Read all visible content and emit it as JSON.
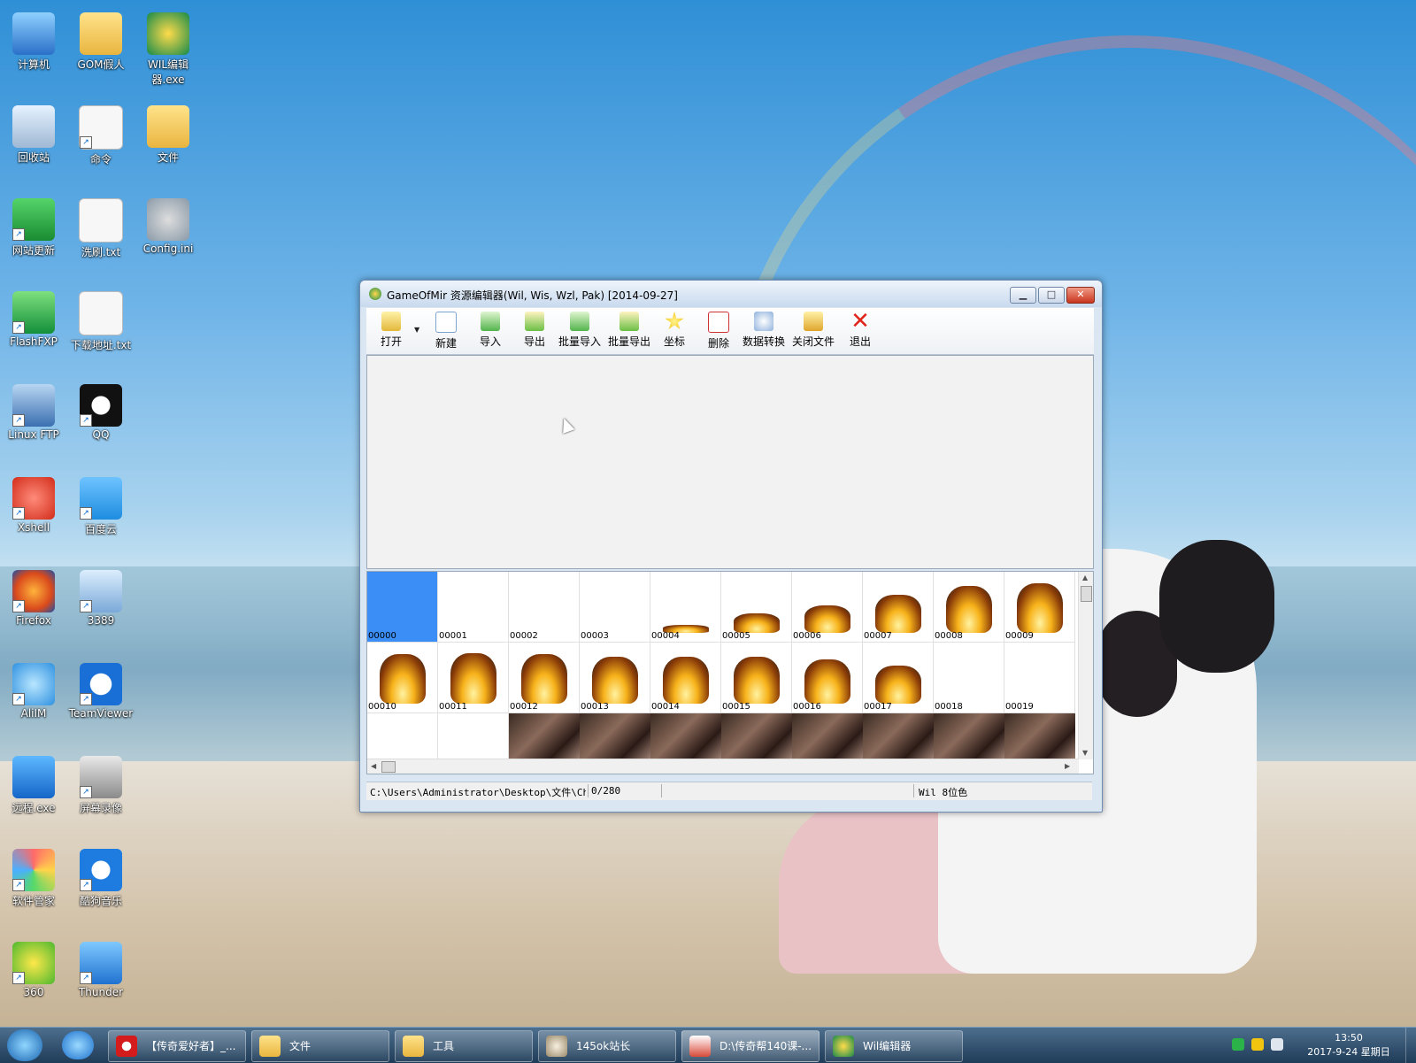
{
  "desktop": {
    "icons": [
      {
        "label": "计算机",
        "icon": "computer-icon",
        "shortcut": false
      },
      {
        "label": "GOM假人",
        "icon": "folder-icon",
        "shortcut": false
      },
      {
        "label": "WIL编辑器.exe",
        "icon": "wil-editor-icon",
        "shortcut": false
      },
      {
        "label": "回收站",
        "icon": "recycle-bin-icon",
        "shortcut": false
      },
      {
        "label": "命令",
        "icon": "document-icon",
        "shortcut": true
      },
      {
        "label": "文件",
        "icon": "folder-icon",
        "shortcut": false
      },
      {
        "label": "网站更新",
        "icon": "shield-icon",
        "shortcut": true
      },
      {
        "label": "洗刷.txt",
        "icon": "text-file-icon",
        "shortcut": false
      },
      {
        "label": "Config.ini",
        "icon": "config-file-icon",
        "shortcut": false
      },
      {
        "label": "FlashFXP",
        "icon": "flashfxp-icon",
        "shortcut": true
      },
      {
        "label": "下载地址.txt",
        "icon": "text-file-icon",
        "shortcut": false
      },
      {
        "label": "Linux FTP",
        "icon": "ftp-icon",
        "shortcut": true
      },
      {
        "label": "QQ",
        "icon": "qq-icon",
        "shortcut": true
      },
      {
        "label": "Xshell",
        "icon": "xshell-icon",
        "shortcut": true
      },
      {
        "label": "百度云",
        "icon": "baidu-cloud-icon",
        "shortcut": true
      },
      {
        "label": "Firefox",
        "icon": "firefox-icon",
        "shortcut": true
      },
      {
        "label": "3389",
        "icon": "monitor-icon",
        "shortcut": true
      },
      {
        "label": "AliIM",
        "icon": "aliim-icon",
        "shortcut": true
      },
      {
        "label": "TeamViewer",
        "icon": "teamviewer-icon",
        "shortcut": true
      },
      {
        "label": "远程.exe",
        "icon": "remote-icon",
        "shortcut": false
      },
      {
        "label": "屏幕录像",
        "icon": "screen-recorder-icon",
        "shortcut": true
      },
      {
        "label": "软件管家",
        "icon": "software-manager-icon",
        "shortcut": true
      },
      {
        "label": "酷狗音乐",
        "icon": "kugou-icon",
        "shortcut": true
      },
      {
        "label": "360",
        "icon": "360-icon",
        "shortcut": true
      },
      {
        "label": "Thunder",
        "icon": "thunder-icon",
        "shortcut": true
      }
    ]
  },
  "window": {
    "title": "GameOfMir 资源编辑器(Wil, Wis, Wzl, Pak) [2014-09-27]",
    "controls": {
      "minimize": "▁",
      "maximize": "□",
      "close": "✕"
    },
    "toolbar": {
      "open": "打开",
      "new": "新建",
      "import": "导入",
      "export": "导出",
      "batch_import": "批量导入",
      "batch_export": "批量导出",
      "coordinates": "坐标",
      "delete": "删除",
      "data_convert": "数据转换",
      "close_file": "关闭文件",
      "exit": "退出"
    },
    "thumbnails": [
      {
        "label": "00000",
        "kind": "selected"
      },
      {
        "label": "00001",
        "kind": "empty"
      },
      {
        "label": "00002",
        "kind": "empty"
      },
      {
        "label": "00003",
        "kind": "empty"
      },
      {
        "label": "00004",
        "kind": "flame",
        "level": 0.15
      },
      {
        "label": "00005",
        "kind": "flame",
        "level": 0.35
      },
      {
        "label": "00006",
        "kind": "flame",
        "level": 0.5
      },
      {
        "label": "00007",
        "kind": "flame",
        "level": 0.7
      },
      {
        "label": "00008",
        "kind": "flame",
        "level": 0.85
      },
      {
        "label": "00009",
        "kind": "flame",
        "level": 0.9
      },
      {
        "label": "00010",
        "kind": "flame",
        "level": 0.9
      },
      {
        "label": "00011",
        "kind": "flame",
        "level": 0.92
      },
      {
        "label": "00012",
        "kind": "flame",
        "level": 0.9
      },
      {
        "label": "00013",
        "kind": "flame",
        "level": 0.85
      },
      {
        "label": "00014",
        "kind": "flame",
        "level": 0.85
      },
      {
        "label": "00015",
        "kind": "flame",
        "level": 0.85
      },
      {
        "label": "00016",
        "kind": "flame",
        "level": 0.8
      },
      {
        "label": "00017",
        "kind": "flame",
        "level": 0.7
      },
      {
        "label": "00018",
        "kind": "empty"
      },
      {
        "label": "00019",
        "kind": "empty"
      },
      {
        "label": "",
        "kind": "empty"
      },
      {
        "label": "",
        "kind": "empty"
      },
      {
        "label": "",
        "kind": "scene"
      },
      {
        "label": "",
        "kind": "scene"
      },
      {
        "label": "",
        "kind": "scene"
      },
      {
        "label": "",
        "kind": "scene"
      },
      {
        "label": "",
        "kind": "scene"
      },
      {
        "label": "",
        "kind": "scene"
      },
      {
        "label": "",
        "kind": "scene"
      },
      {
        "label": "",
        "kind": "scene"
      }
    ],
    "status": {
      "path": "C:\\Users\\Administrator\\Desktop\\文件\\ChrSel",
      "position": "0/280",
      "format": "Wil 8位色"
    },
    "colors": {
      "selection": "#3c8ef7",
      "exit_icon": "#e0251b"
    }
  },
  "taskbar": {
    "items": [
      {
        "label": "【传奇爱好者】_...",
        "icon": "opera-icon",
        "active": false
      },
      {
        "label": "文件",
        "icon": "folder-icon",
        "active": false
      },
      {
        "label": "工具",
        "icon": "folder-icon",
        "active": false
      },
      {
        "label": "145ok站长",
        "icon": "app-145ok-icon",
        "active": false
      },
      {
        "label": "D:\\传奇帮140课-...",
        "icon": "edit-file-icon",
        "active": true
      },
      {
        "label": "Wil编辑器",
        "icon": "wil-editor-icon",
        "active": false
      }
    ],
    "clock": {
      "time": "13:50",
      "date": "2017-9-24 星期日"
    }
  }
}
